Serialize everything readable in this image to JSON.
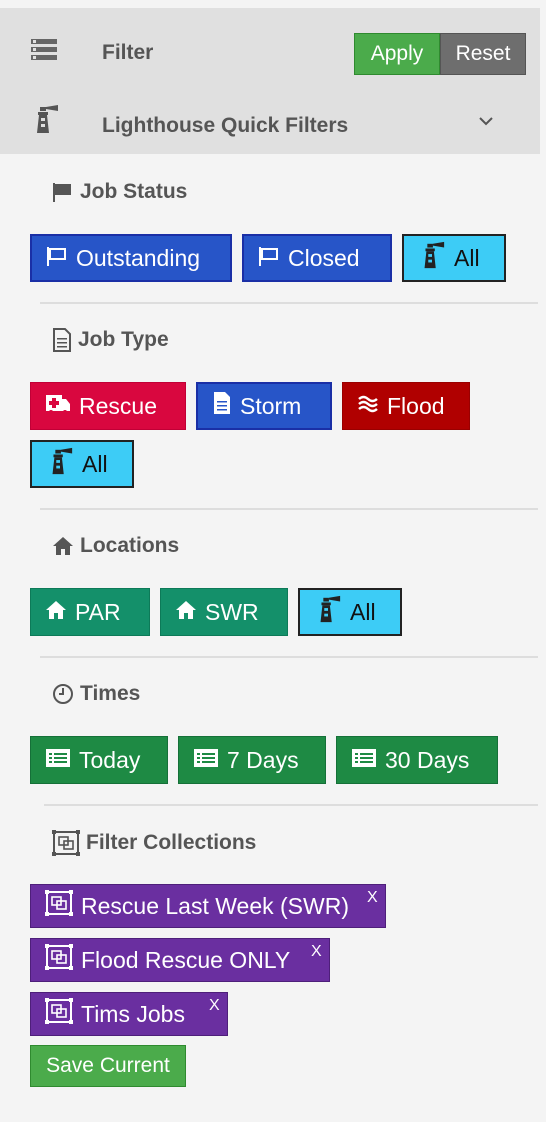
{
  "header": {
    "filter_label": "Filter",
    "apply_label": "Apply",
    "reset_label": "Reset",
    "quick_filters_label": "Lighthouse Quick Filters"
  },
  "job_status": {
    "title": "Job Status",
    "chips": [
      "Outstanding",
      "Closed",
      "All"
    ]
  },
  "job_type": {
    "title": "Job Type",
    "chips": [
      "Rescue",
      "Storm",
      "Flood",
      "All"
    ]
  },
  "locations": {
    "title": "Locations",
    "chips": [
      "PAR",
      "SWR",
      "All"
    ]
  },
  "times": {
    "title": "Times",
    "chips": [
      "Today",
      "7 Days",
      "30 Days"
    ]
  },
  "collections": {
    "title": "Filter Collections",
    "items": [
      "Rescue Last Week (SWR)",
      "Flood Rescue ONLY",
      "Tims Jobs"
    ],
    "remove_label": "X",
    "save_label": "Save Current"
  },
  "colors": {
    "status_blue": "#2755c8",
    "all_cyan": "#3dccf6",
    "rescue_red": "#d9073f",
    "flood_red": "#b00000",
    "location_teal": "#14906a",
    "time_green": "#1e8a44",
    "collection_purple": "#6a2fa0",
    "apply_green": "#4bab4b",
    "reset_gray": "#6e6e6e"
  },
  "icons": [
    "list-icon",
    "lighthouse-icon",
    "chevron-down-icon",
    "flag-icon",
    "document-icon",
    "home-icon",
    "clock-icon",
    "collection-icon",
    "ambulance-icon",
    "waves-icon",
    "calendar-list-icon"
  ]
}
